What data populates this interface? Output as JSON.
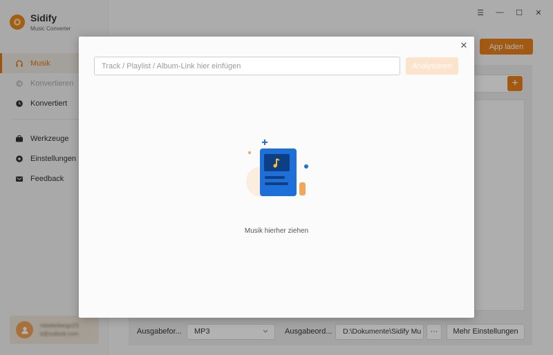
{
  "app": {
    "title": "Sidify",
    "subtitle": "Music Converter"
  },
  "sidebar": {
    "items": [
      {
        "label": "Musik",
        "icon": "headphones-icon"
      },
      {
        "label": "Konvertieren",
        "icon": "convert-icon"
      },
      {
        "label": "Konvertiert",
        "icon": "clock-icon"
      },
      {
        "label": "Werkzeuge",
        "icon": "toolbox-icon"
      },
      {
        "label": "Einstellungen",
        "icon": "gear-icon"
      },
      {
        "label": "Feedback",
        "icon": "mail-icon"
      }
    ],
    "user": {
      "name": "mbelanbergo23",
      "email": "ti@outlook.com"
    }
  },
  "window_controls": {
    "menu": "☰",
    "minimize": "—",
    "maximize": "☐",
    "close": "✕"
  },
  "header": {
    "load_app_label": "App laden"
  },
  "bottom": {
    "output_format_label": "Ausgabefor...",
    "output_format_value": "MP3",
    "output_folder_label": "Ausgabeord...",
    "output_folder_value": "D:\\Dokumente\\Sidify Mu",
    "browse_label": "···",
    "more_settings_label": "Mehr Einstellungen"
  },
  "dialog": {
    "input_placeholder": "Track / Playlist / Album-Link hier einfügen",
    "analyze_label": "Analysieren",
    "drop_text": "Musik hierher ziehen",
    "close": "✕"
  },
  "colors": {
    "accent": "#e8811a",
    "illustration_blue": "#1f6fd8"
  }
}
